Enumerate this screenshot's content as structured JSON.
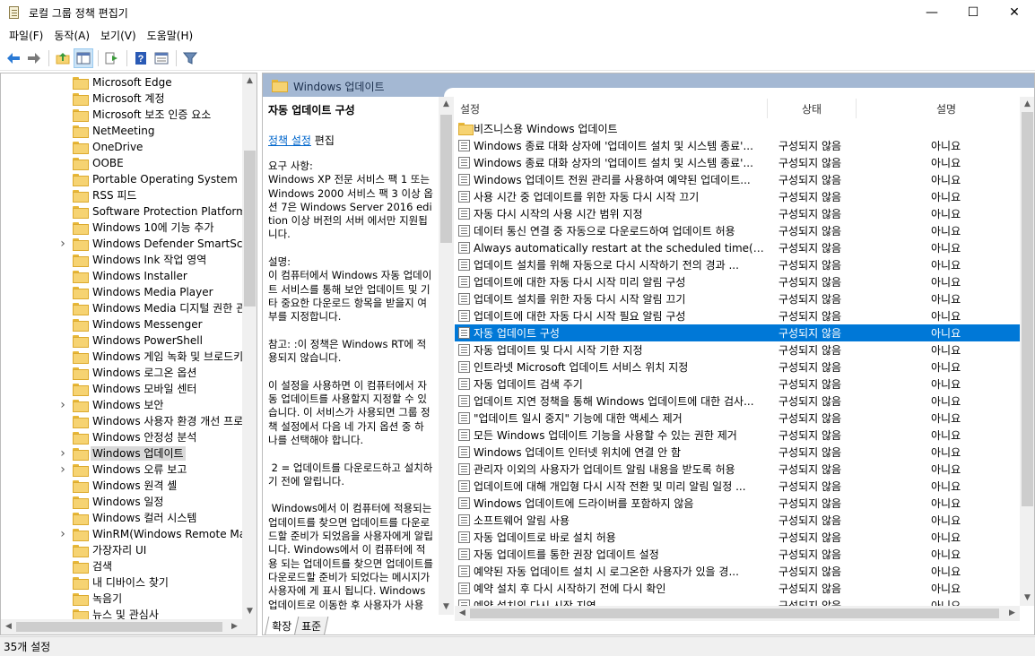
{
  "window": {
    "title": "로컬 그룹 정책 편집기",
    "minimize_glyph": "—",
    "maximize_glyph": "☐",
    "close_glyph": "✕"
  },
  "menu": [
    "파일(F)",
    "동작(A)",
    "보기(V)",
    "도움말(H)"
  ],
  "toolbar": {
    "icons": [
      "back-arrow-icon",
      "forward-arrow-icon",
      "up-folder-icon",
      "show-hide-tree-icon",
      "export-list-icon",
      "help-icon",
      "properties-view-icon",
      "filter-icon"
    ]
  },
  "tree": {
    "items": [
      {
        "label": "Microsoft Edge",
        "expandable": false
      },
      {
        "label": "Microsoft 계정",
        "expandable": false
      },
      {
        "label": "Microsoft 보조 인증 요소",
        "expandable": false
      },
      {
        "label": "NetMeeting",
        "expandable": false
      },
      {
        "label": "OneDrive",
        "expandable": false
      },
      {
        "label": "OOBE",
        "expandable": false
      },
      {
        "label": "Portable Operating System",
        "expandable": false
      },
      {
        "label": "RSS 피드",
        "expandable": false
      },
      {
        "label": "Software Protection Platform",
        "expandable": false
      },
      {
        "label": "Windows 10에 기능 추가",
        "expandable": false
      },
      {
        "label": "Windows Defender SmartScree",
        "expandable": true
      },
      {
        "label": "Windows Ink 작업 영역",
        "expandable": false
      },
      {
        "label": "Windows Installer",
        "expandable": false
      },
      {
        "label": "Windows Media Player",
        "expandable": false
      },
      {
        "label": "Windows Media 디지털 권한 관",
        "expandable": false
      },
      {
        "label": "Windows Messenger",
        "expandable": false
      },
      {
        "label": "Windows PowerShell",
        "expandable": false
      },
      {
        "label": "Windows 게임 녹화 및 브로드키",
        "expandable": false
      },
      {
        "label": "Windows 로그온 옵션",
        "expandable": false
      },
      {
        "label": "Windows 모바일 센터",
        "expandable": false
      },
      {
        "label": "Windows 보안",
        "expandable": true
      },
      {
        "label": "Windows 사용자 환경 개선 프로",
        "expandable": false
      },
      {
        "label": "Windows 안정성 분석",
        "expandable": false
      },
      {
        "label": "Windows 업데이트",
        "expandable": true,
        "selected": true
      },
      {
        "label": "Windows 오류 보고",
        "expandable": true
      },
      {
        "label": "Windows 원격 셸",
        "expandable": false
      },
      {
        "label": "Windows 일정",
        "expandable": false
      },
      {
        "label": "Windows 컬러 시스템",
        "expandable": false
      },
      {
        "label": "WinRM(Windows Remote Mana",
        "expandable": true
      },
      {
        "label": "가장자리 UI",
        "expandable": false
      },
      {
        "label": "검색",
        "expandable": false
      },
      {
        "label": "내 디바이스 찾기",
        "expandable": false
      },
      {
        "label": "녹음기",
        "expandable": false
      },
      {
        "label": "뉴스 및 관심사",
        "expandable": false
      }
    ]
  },
  "header": {
    "title": "Windows 업데이트"
  },
  "description": {
    "title": "자동 업데이트 구성",
    "edit_link": "정책 설정",
    "edit_suffix": " 편집",
    "body": "요구 사항:\nWindows XP 전문 서비스 팩 1 또는 Windows 2000 서비스 팩 3 이상 옵션 7은 Windows Server 2016 edition 이상 버전의 서버 에서만 지원됩니다.\n\n설명:\n이 컴퓨터에서 Windows 자동 업데이트 서비스를 통해 보안 업데이트 및 기타 중요한 다운로드 항목을 받을지 여부를 지정합니다.\n\n참고: :이 정책은 Windows RT에 적용되지 않습니다.\n\n이 설정을 사용하면 이 컴퓨터에서 자동 업데이트를 사용할지 지정할 수 있습니다. 이 서비스가 사용되면 그룹 정책 설정에서 다음 네 가지 옵션 중 하나를 선택해야 합니다.\n\n 2 = 업데이트를 다운로드하고 설치하기 전에 알립니다.\n\n Windows에서 이 컴퓨터에 적용되는 업데이트를 찾으면 업데이트를 다운로드할 준비가 되었음을 사용자에게 알립니다. Windows에서 이 컴퓨터에 적용 되는 업데이트를 찾으면 업데이트를 다운로드할 준비가 되었다는 메시지가 사용자에 게 표시 됩니다. Windows 업데이트로 이동한 후 사용자가 사용"
  },
  "tabs": [
    "확장",
    "표준"
  ],
  "list": {
    "columns": [
      "설정",
      "상태",
      "설명"
    ],
    "rows": [
      {
        "name": "비즈니스용 Windows 업데이트",
        "state": "",
        "comment": "",
        "folder": true
      },
      {
        "name": "Windows 종료 대화 상자에 '업데이트 설치 및 시스템 종료'...",
        "state": "구성되지 않음",
        "comment": "아니요"
      },
      {
        "name": "Windows 종료 대화 상자의 '업데이트 설치 및 시스템 종료'...",
        "state": "구성되지 않음",
        "comment": "아니요"
      },
      {
        "name": "Windows 업데이트 전원 관리를 사용하여 예약된 업데이트...",
        "state": "구성되지 않음",
        "comment": "아니요"
      },
      {
        "name": "사용 시간 중 업데이트를 위한 자동 다시 시작 끄기",
        "state": "구성되지 않음",
        "comment": "아니요"
      },
      {
        "name": "자동 다시 시작의 사용 시간 범위 지정",
        "state": "구성되지 않음",
        "comment": "아니요"
      },
      {
        "name": "데이터 통신 연결 중 자동으로 다운로드하여 업데이트 허용",
        "state": "구성되지 않음",
        "comment": "아니요"
      },
      {
        "name": "Always automatically restart at the scheduled time(항상 예...",
        "state": "구성되지 않음",
        "comment": "아니요"
      },
      {
        "name": "업데이트 설치를 위해 자동으로 다시 시작하기 전의 경과 ...",
        "state": "구성되지 않음",
        "comment": "아니요"
      },
      {
        "name": "업데이트에 대한 자동 다시 시작 미리 알림 구성",
        "state": "구성되지 않음",
        "comment": "아니요"
      },
      {
        "name": "업데이트 설치를 위한 자동 다시 시작 알림 끄기",
        "state": "구성되지 않음",
        "comment": "아니요"
      },
      {
        "name": "업데이트에 대한 자동 다시 시작 필요 알림 구성",
        "state": "구성되지 않음",
        "comment": "아니요"
      },
      {
        "name": "자동 업데이트 구성",
        "state": "구성되지 않음",
        "comment": "아니요",
        "selected": true
      },
      {
        "name": "자동 업데이트 및 다시 시작 기한 지정",
        "state": "구성되지 않음",
        "comment": "아니요"
      },
      {
        "name": "인트라넷 Microsoft 업데이트 서비스 위치 지정",
        "state": "구성되지 않음",
        "comment": "아니요"
      },
      {
        "name": "자동 업데이트 검색 주기",
        "state": "구성되지 않음",
        "comment": "아니요"
      },
      {
        "name": "업데이트 지연 정책을 통해 Windows 업데이트에 대한 검사...",
        "state": "구성되지 않음",
        "comment": "아니요"
      },
      {
        "name": "\"업데이트 일시 중지\" 기능에 대한 액세스 제거",
        "state": "구성되지 않음",
        "comment": "아니요"
      },
      {
        "name": "모든 Windows 업데이트 기능을 사용할 수 있는 권한 제거",
        "state": "구성되지 않음",
        "comment": "아니요"
      },
      {
        "name": "Windows 업데이트 인터넷 위치에 연결 안 함",
        "state": "구성되지 않음",
        "comment": "아니요"
      },
      {
        "name": "관리자 이외의 사용자가 업데이트 알림 내용을 받도록 허용",
        "state": "구성되지 않음",
        "comment": "아니요"
      },
      {
        "name": "업데이트에 대해 개입형 다시 시작 전환 및 미리 알림 일정 ...",
        "state": "구성되지 않음",
        "comment": "아니요"
      },
      {
        "name": "Windows 업데이트에 드라이버를 포함하지 않음",
        "state": "구성되지 않음",
        "comment": "아니요"
      },
      {
        "name": "소프트웨어 알림 사용",
        "state": "구성되지 않음",
        "comment": "아니요"
      },
      {
        "name": "자동 업데이트로 바로 설치 허용",
        "state": "구성되지 않음",
        "comment": "아니요"
      },
      {
        "name": "자동 업데이트를 통한 권장 업데이트 설정",
        "state": "구성되지 않음",
        "comment": "아니요"
      },
      {
        "name": "예약된 자동 업데이트 설치 시 로그온한 사용자가 있을 경...",
        "state": "구성되지 않음",
        "comment": "아니요"
      },
      {
        "name": "예약 설치 후 다시 시작하기 전에 다시 확인",
        "state": "구성되지 않음",
        "comment": "아니요"
      },
      {
        "name": "예약 설치의 다시 시작 지연",
        "state": "구성되지 않음",
        "comment": "아니요"
      }
    ]
  },
  "status": {
    "text": "35개 설정"
  },
  "colors": {
    "selection": "#0078d7",
    "header_band": "#a4b8d3",
    "link": "#0066cc"
  }
}
